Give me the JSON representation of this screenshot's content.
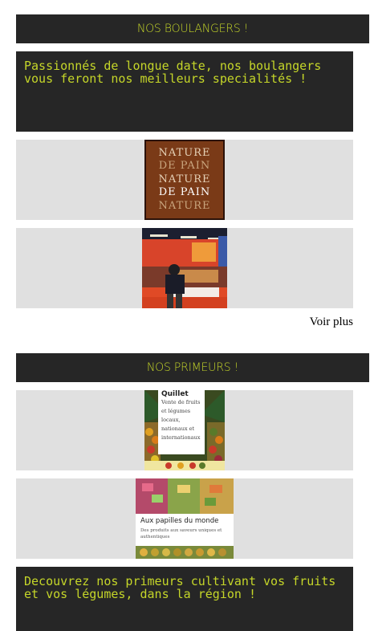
{
  "boulangers": {
    "title": "NOS BOULANGERS !",
    "intro": "Passionnés de longue date, nos boulangers vous feront nos meilleurs specialités !",
    "logo_lines": [
      "NATURE",
      "DE PAIN",
      "NATURE",
      "DE PAIN",
      "NATURE"
    ],
    "voir_plus": "Voir plus"
  },
  "primeurs": {
    "title": "NOS PRIMEURS !",
    "quillet": {
      "name": "Quillet",
      "description": "Vente de fruits et légumes locaux, nationaux et internationaux"
    },
    "papilles": {
      "name": "Aux papilles du monde",
      "description": "Des produits aux saveurs uniques et authentiques"
    },
    "intro": "Decouvrez nos primeurs cultivant vos fruits et vos légumes, dans la région !"
  },
  "colors": {
    "dark_bg": "#262626",
    "accent": "#c5d629",
    "row_bg": "#e0e0e0",
    "logo_brown": "#7a3a17"
  }
}
